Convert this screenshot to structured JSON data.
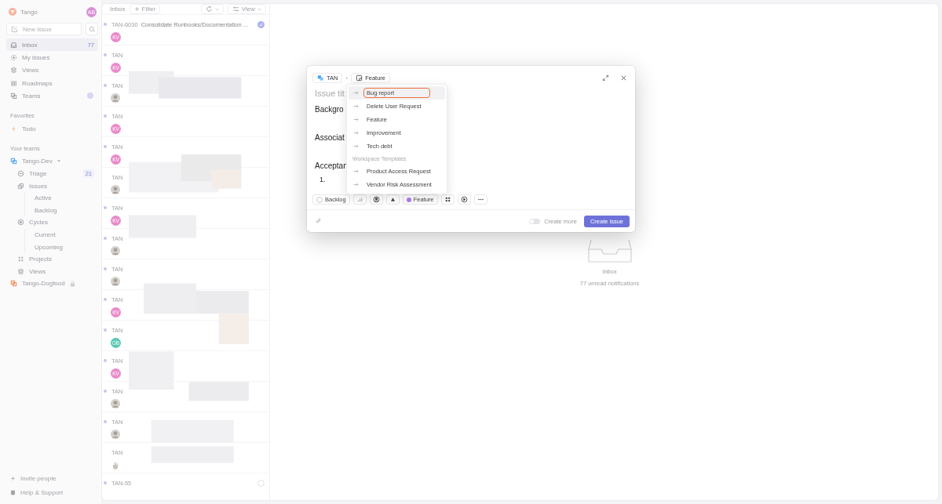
{
  "sidebar": {
    "workspace": "Tango",
    "user_initials": "AB",
    "new_issue": "New issue",
    "nav": [
      {
        "label": "Inbox",
        "count": "77",
        "selected": true
      },
      {
        "label": "My issues",
        "selected": false
      },
      {
        "label": "Views",
        "selected": false
      },
      {
        "label": "Roadmaps",
        "selected": false
      },
      {
        "label": "Teams",
        "selected": false,
        "badge": true
      }
    ],
    "favorites": {
      "heading": "Favorites",
      "items": [
        {
          "label": "Todo"
        }
      ]
    },
    "teams": {
      "heading": "Your teams",
      "items": [
        {
          "label": "Tango-Dev",
          "color": "#5aa6e8",
          "expanded": true,
          "locked": false,
          "children": [
            {
              "label": "Triage",
              "count": "21"
            },
            {
              "label": "Issues",
              "children": [
                {
                  "label": "Active"
                },
                {
                  "label": "Backlog"
                }
              ]
            },
            {
              "label": "Cycles",
              "children": [
                {
                  "label": "Current"
                },
                {
                  "label": "Upcoming"
                }
              ]
            },
            {
              "label": "Projects"
            },
            {
              "label": "Views"
            }
          ]
        },
        {
          "label": "Tango-Dogfood",
          "color": "#f08a5d",
          "locked": true
        }
      ]
    },
    "footer": [
      {
        "label": "Invite people"
      },
      {
        "label": "Help & Support"
      }
    ]
  },
  "inbox": {
    "title": "Inbox",
    "filter": "Filter",
    "view": "View",
    "rows": [
      {
        "id": "TAN-6030",
        "title": "Consolidate Runbooks/Documentation ...",
        "unread": true,
        "completed": true,
        "avatar": {
          "kind": "initials",
          "text": "KV",
          "color": "#e98bc9"
        }
      },
      {
        "id": "TAN",
        "unread": true,
        "avatar": {
          "kind": "initials",
          "text": "KV",
          "color": "#e98bc9"
        }
      },
      {
        "id": "TAN",
        "unread": true
      },
      {
        "id": "TAN",
        "unread": true,
        "avatar": {
          "kind": "initials",
          "text": "KV",
          "color": "#e98bc9"
        }
      },
      {
        "id": "TAN",
        "unread": true,
        "avatar": {
          "kind": "initials",
          "text": "KV",
          "color": "#e98bc9"
        }
      },
      {
        "id": "TAN",
        "unread": false
      },
      {
        "id": "TAN",
        "unread": true,
        "avatar": {
          "kind": "initials",
          "text": "KV",
          "color": "#e98bc9"
        }
      },
      {
        "id": "TAN",
        "unread": true
      },
      {
        "id": "TAN",
        "unread": true
      },
      {
        "id": "TAN",
        "unread": true,
        "avatar": {
          "kind": "initials",
          "text": "KV",
          "color": "#e98bc9"
        }
      },
      {
        "id": "TAN",
        "unread": true,
        "avatar": {
          "kind": "initials",
          "text": "OB",
          "color": "#5cc9b5"
        }
      },
      {
        "id": "TAN",
        "unread": true,
        "avatar": {
          "kind": "initials",
          "text": "KV",
          "color": "#e98bc9"
        }
      },
      {
        "id": "TAN",
        "unread": true
      },
      {
        "id": "TAN",
        "unread": true
      },
      {
        "id": "TAN",
        "unread": false,
        "avatar": {
          "kind": "hand"
        }
      },
      {
        "id": "TAN-55",
        "unread": true,
        "completed": false
      }
    ]
  },
  "empty_state": {
    "title": "Inbox",
    "subtitle": "77 unread notifications"
  },
  "modal": {
    "team": "TAN",
    "separator": "›",
    "template": "Feature",
    "title_placeholder": "Issue tit",
    "sections": [
      "Backgro",
      "Associat",
      "Acceptan"
    ],
    "list_marker": "1.",
    "team_templates": [
      {
        "label": "Bug report",
        "selected": true
      },
      {
        "label": "Delete User Request",
        "selected": false
      },
      {
        "label": "Feature",
        "selected": false
      },
      {
        "label": "Improvement",
        "selected": false
      },
      {
        "label": "Tech debt",
        "selected": false
      }
    ],
    "workspace_heading": "Workspace Templates",
    "workspace_templates": [
      {
        "label": "Product Access Request",
        "selected": false
      },
      {
        "label": "Vendor Risk Assessment",
        "selected": false
      }
    ],
    "properties": [
      {
        "kind": "status",
        "label": "Backlog"
      },
      {
        "kind": "priority"
      },
      {
        "kind": "assignee"
      },
      {
        "kind": "estimate"
      },
      {
        "kind": "label",
        "label": "Feature",
        "color": "#b27cf0"
      },
      {
        "kind": "project"
      },
      {
        "kind": "cycle"
      },
      {
        "kind": "more"
      }
    ],
    "create_more": {
      "label": "Create more",
      "on": false
    },
    "submit": "Create issue"
  }
}
